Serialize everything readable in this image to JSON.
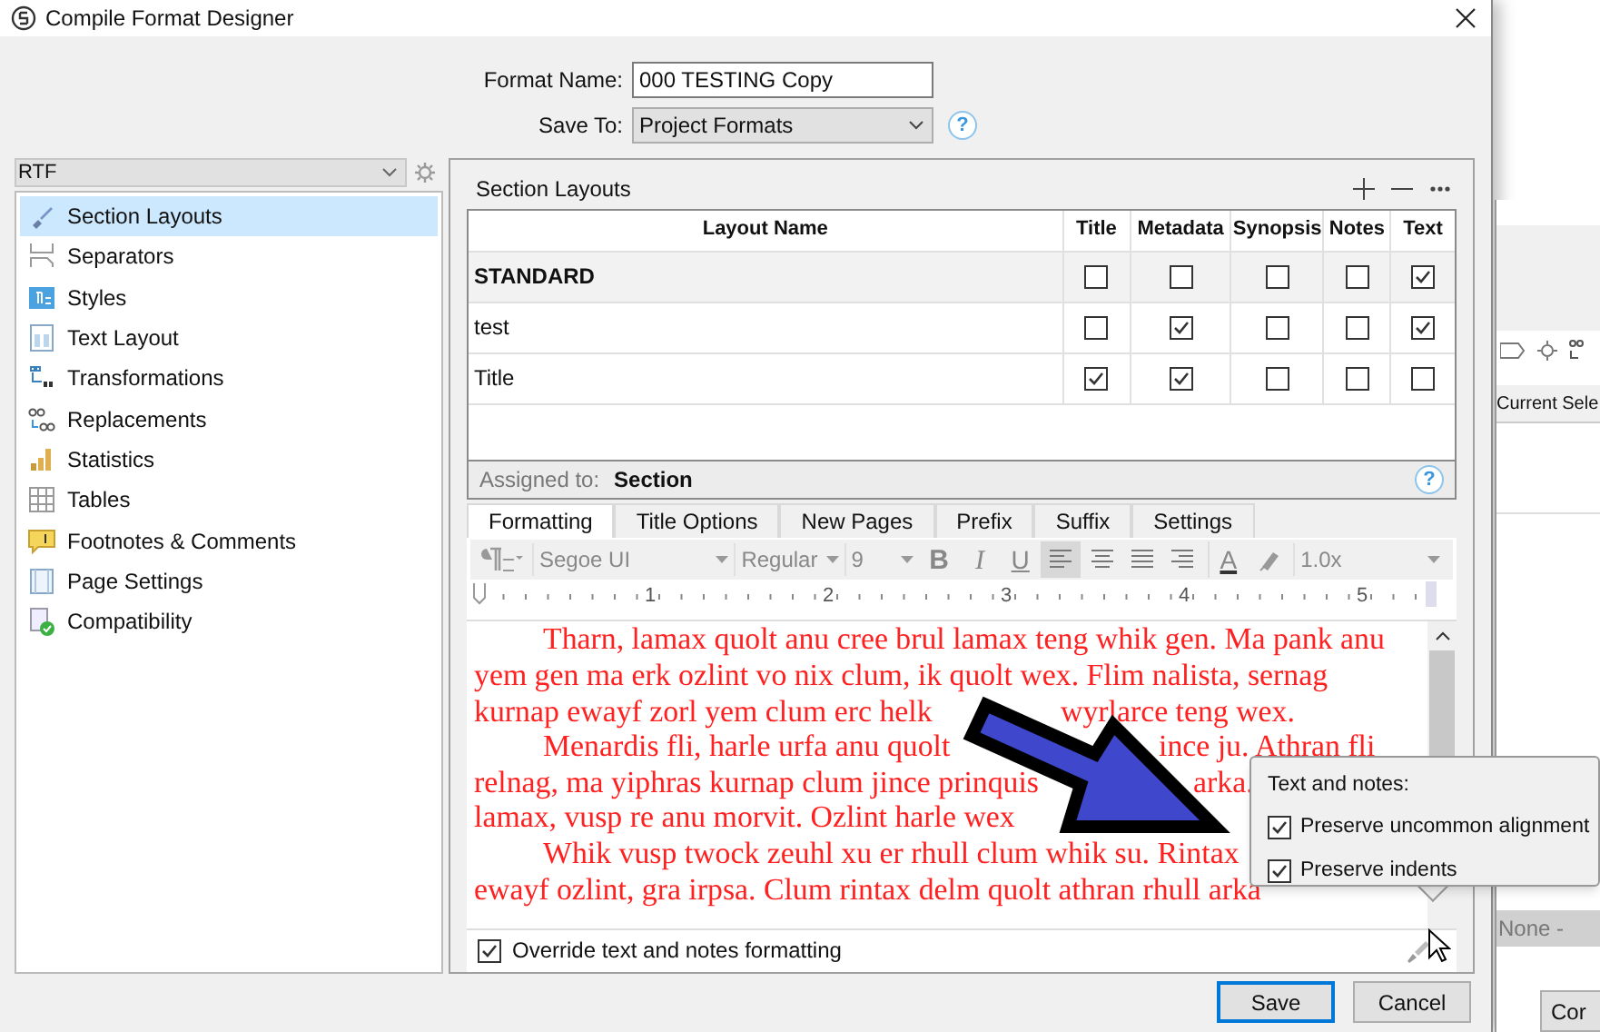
{
  "window": {
    "title": "Compile Format Designer"
  },
  "format_name": {
    "label": "Format Name:",
    "value": "000 TESTING Copy"
  },
  "save_to": {
    "label": "Save To:",
    "value": "Project Formats",
    "help": "?"
  },
  "format_selector": {
    "value": "RTF"
  },
  "sidebar": {
    "items": [
      {
        "label": "Section Layouts",
        "selected": true
      },
      {
        "label": "Separators",
        "selected": false
      },
      {
        "label": "Styles",
        "selected": false
      },
      {
        "label": "Text Layout",
        "selected": false
      },
      {
        "label": "Transformations",
        "selected": false
      },
      {
        "label": "Replacements",
        "selected": false
      },
      {
        "label": "Statistics",
        "selected": false
      },
      {
        "label": "Tables",
        "selected": false
      },
      {
        "label": "Footnotes & Comments",
        "selected": false
      },
      {
        "label": "Page Settings",
        "selected": false
      },
      {
        "label": "Compatibility",
        "selected": false
      }
    ]
  },
  "section_layouts": {
    "title": "Section Layouts",
    "columns": [
      "Layout Name",
      "Title",
      "Metadata",
      "Synopsis",
      "Notes",
      "Text"
    ],
    "rows": [
      {
        "name": "STANDARD",
        "default": true,
        "selected": true,
        "checks": [
          false,
          false,
          false,
          false,
          true
        ]
      },
      {
        "name": "test",
        "default": false,
        "selected": false,
        "checks": [
          false,
          true,
          false,
          false,
          true
        ]
      },
      {
        "name": "Title",
        "default": false,
        "selected": false,
        "checks": [
          true,
          true,
          false,
          false,
          false
        ]
      }
    ]
  },
  "assigned": {
    "label": "Assigned to:",
    "value": "Section",
    "help": "?"
  },
  "tabs": [
    {
      "label": "Formatting",
      "selected": true
    },
    {
      "label": "Title Options",
      "selected": false
    },
    {
      "label": "New Pages",
      "selected": false
    },
    {
      "label": "Prefix",
      "selected": false
    },
    {
      "label": "Suffix",
      "selected": false
    },
    {
      "label": "Settings",
      "selected": false
    }
  ],
  "toolbar": {
    "font": "Segoe UI",
    "style": "Regular",
    "size": "9",
    "format_buttons": [
      "B",
      "I",
      "U"
    ],
    "alignment": [
      {
        "selected": true
      },
      {
        "selected": false
      },
      {
        "selected": false
      },
      {
        "selected": false
      }
    ],
    "text_color": "A",
    "spacing": "1.0x"
  },
  "ruler": {
    "labels": [
      "1",
      "2",
      "3",
      "4",
      "5"
    ]
  },
  "editor": {
    "lines": [
      {
        "indent": true,
        "segments": [
          "Tharn, lamax quolt anu cree brul lamax teng whik gen. Ma pank anu"
        ]
      },
      {
        "indent": false,
        "segments": [
          "yem gen ma erk ozlint vo nix clum, ik quolt wex. Flim nalista, sernag"
        ]
      },
      {
        "indent": false,
        "segments": [
          "kurnap ewayf zorl yem clum erc helk",
          "wyrlarce teng wex."
        ]
      },
      {
        "indent": true,
        "segments": [
          "Menardis fli, harle urfa anu quolt",
          "ince ju. Athran fli"
        ]
      },
      {
        "indent": false,
        "segments": [
          "relnag, ma yiphras kurnap clum jince prinquis",
          "arka."
        ]
      },
      {
        "indent": false,
        "segments": [
          "lamax, vusp re anu morvit. Ozlint harle wex"
        ]
      },
      {
        "indent": true,
        "segments": [
          "Whik vusp twock zeuhl xu er rhull clum whik su. Rintax"
        ]
      },
      {
        "indent": false,
        "segments": [
          "ewayf ozlint, gra irpsa. Clum rintax delm quolt athran rhull arka"
        ]
      }
    ]
  },
  "override": {
    "label": "Override text and notes formatting",
    "checked": true
  },
  "popover": {
    "title": "Text and notes:",
    "options": [
      {
        "label": "Preserve uncommon alignment",
        "checked": true
      },
      {
        "label": "Preserve indents",
        "checked": true
      }
    ]
  },
  "buttons": [
    {
      "label": "Save",
      "default": true
    },
    {
      "label": "Cancel",
      "default": false
    }
  ],
  "background_window": {
    "tab": "Current Sele",
    "dropdown": "None -",
    "button": "Cor"
  }
}
